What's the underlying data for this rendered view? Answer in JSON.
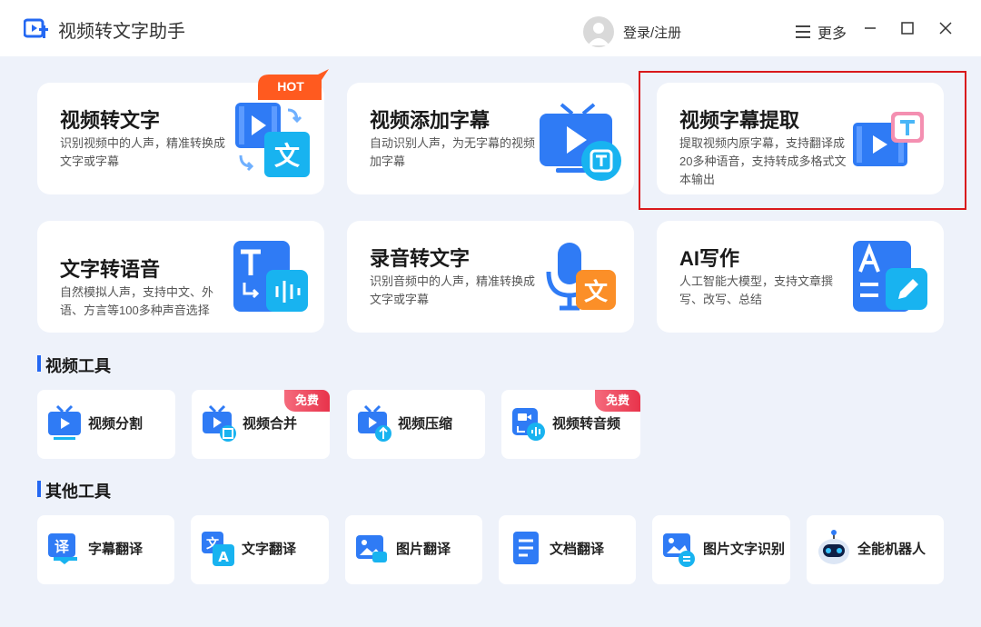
{
  "app": {
    "title": "视频转文字助手",
    "login_label": "登录/注册",
    "menu_label": "更多",
    "accent": "#2468f2"
  },
  "feature_cards": [
    {
      "title": "视频转文字",
      "desc": "识别视频中的人声，精准转换成文字或字幕",
      "badge": "HOT",
      "icon": "video-to-text-icon"
    },
    {
      "title": "视频添加字幕",
      "desc": "自动识别人声，为无字幕的视频加字幕",
      "icon": "tv-subtitle-icon"
    },
    {
      "title": "视频字幕提取",
      "desc": "提取视频内原字幕，支持翻译成20多种语音，支持转成多格式文本输出",
      "icon": "subtitle-extract-icon"
    },
    {
      "title": "文字转语音",
      "desc": "自然模拟人声，支持中文、外语、方言等100多种声音选择",
      "icon": "text-to-speech-icon"
    },
    {
      "title": "录音转文字",
      "desc": "识别音频中的人声，精准转换成文字或字幕",
      "icon": "microphone-text-icon"
    },
    {
      "title": "AI写作",
      "desc": "人工智能大模型，支持文章撰写、改写、总结",
      "icon": "ai-writing-icon"
    }
  ],
  "video_tools": {
    "title": "视频工具",
    "items": [
      {
        "label": "视频分割",
        "icon": "video-split-icon"
      },
      {
        "label": "视频合并",
        "icon": "video-merge-icon",
        "badge": "免费"
      },
      {
        "label": "视频压缩",
        "icon": "video-compress-icon"
      },
      {
        "label": "视频转音频",
        "icon": "video-to-audio-icon",
        "badge": "免费"
      }
    ]
  },
  "other_tools": {
    "title": "其他工具",
    "items": [
      {
        "label": "字幕翻译",
        "icon": "subtitle-translate-icon"
      },
      {
        "label": "文字翻译",
        "icon": "text-translate-icon"
      },
      {
        "label": "图片翻译",
        "icon": "image-translate-icon"
      },
      {
        "label": "文档翻译",
        "icon": "document-translate-icon"
      },
      {
        "label": "图片文字识别",
        "icon": "image-ocr-icon"
      },
      {
        "label": "全能机器人",
        "icon": "robot-icon"
      }
    ]
  }
}
